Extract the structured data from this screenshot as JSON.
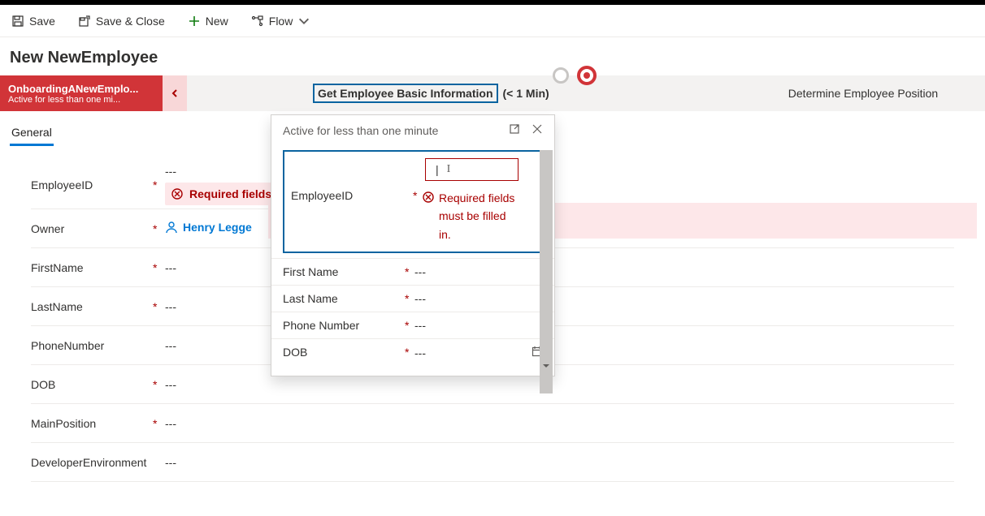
{
  "toolbar": {
    "save": "Save",
    "save_close": "Save & Close",
    "new": "New",
    "flow": "Flow"
  },
  "page_title": "New NewEmployee",
  "bpf": {
    "stage0_title": "OnboardingANewEmplo...",
    "stage0_sub": "Active for less than one mi...",
    "stage1_label": "Get Employee Basic Information",
    "stage1_dur": "(< 1 Min)",
    "stage2_label": "Determine Employee Position"
  },
  "tab": "General",
  "form": {
    "employee_id_label": "EmployeeID",
    "employee_id_value": "---",
    "required_err": "Required fields",
    "owner_label": "Owner",
    "owner_value": "Henry Legge",
    "firstname_label": "FirstName",
    "lastname_label": "LastName",
    "phone_label": "PhoneNumber",
    "dob_label": "DOB",
    "mainpos_label": "MainPosition",
    "devenv_label": "DeveloperEnvironment",
    "dash": "---"
  },
  "flyout": {
    "header": "Active for less than one minute",
    "employee_id_label": "EmployeeID",
    "required_err": "Required fields must be filled in.",
    "firstname": "First Name",
    "lastname": "Last Name",
    "phone": "Phone Number",
    "dob": "DOB",
    "dash": "---",
    "cursor": "|"
  }
}
